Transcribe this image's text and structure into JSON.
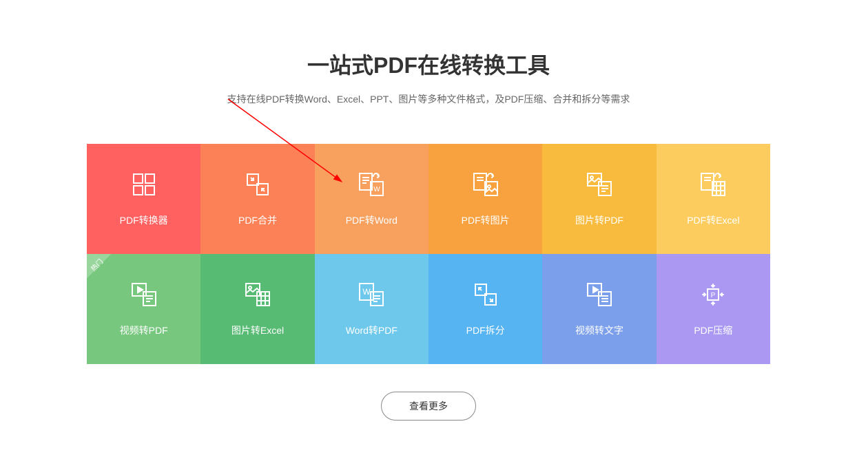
{
  "title": "一站式PDF在线转换工具",
  "subtitle": "支持在线PDF转换Word、Excel、PPT、图片等多种文件格式，及PDF压缩、合并和拆分等需求",
  "tiles": [
    {
      "label": "PDF转换器",
      "color": "#FF6160",
      "icon": "grid-icon"
    },
    {
      "label": "PDF合并",
      "color": "#FD8156",
      "icon": "merge-icon"
    },
    {
      "label": "PDF转Word",
      "color": "#F8A15F",
      "icon": "doc-word-icon"
    },
    {
      "label": "PDF转图片",
      "color": "#F7A23E",
      "icon": "doc-image-icon"
    },
    {
      "label": "图片转PDF",
      "color": "#F9BB3E",
      "icon": "image-doc-icon"
    },
    {
      "label": "PDF转Excel",
      "color": "#FCCC5F",
      "icon": "doc-excel-icon"
    },
    {
      "label": "视频转PDF",
      "color": "#77C87E",
      "icon": "video-doc-icon",
      "hot": true
    },
    {
      "label": "图片转Excel",
      "color": "#58BB74",
      "icon": "image-excel-icon"
    },
    {
      "label": "Word转PDF",
      "color": "#6EC8EB",
      "icon": "word-doc-icon"
    },
    {
      "label": "PDF拆分",
      "color": "#56B4F2",
      "icon": "split-icon"
    },
    {
      "label": "视频转文字",
      "color": "#7B9FEA",
      "icon": "video-text-icon"
    },
    {
      "label": "PDF压缩",
      "color": "#AA98F2",
      "icon": "compress-icon"
    }
  ],
  "more_button": "查看更多",
  "hot_label": "热门"
}
